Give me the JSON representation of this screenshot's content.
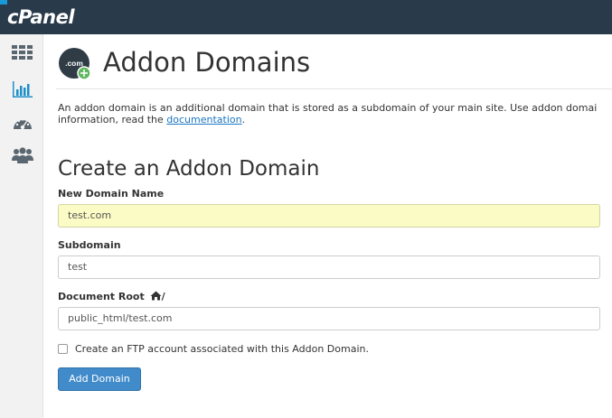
{
  "header": {
    "logo": "cPanel"
  },
  "sidebar": {
    "icons": [
      "grid-icon",
      "bar-chart-icon",
      "dashboard-gauge-icon",
      "users-icon"
    ]
  },
  "page": {
    "icon_text": ".com",
    "title": "Addon Domains",
    "description_part1": "An addon domain is an additional domain that is stored as a subdomain of your main site. Use addon domai",
    "description_part2": "information, read the ",
    "doc_link": "documentation",
    "description_part3": "."
  },
  "form": {
    "section_title": "Create an Addon Domain",
    "new_domain_label": "New Domain Name",
    "new_domain_value": "test.com",
    "subdomain_label": "Subdomain",
    "subdomain_value": "test",
    "docroot_label": "Document Root",
    "docroot_suffix": "/",
    "docroot_value": "public_html/test.com",
    "ftp_checkbox_label": "Create an FTP account associated with this Addon Domain.",
    "ftp_checked": false,
    "submit_label": "Add Domain"
  },
  "colors": {
    "topbar": "#293a4a",
    "accent": "#179bd7",
    "button": "#428bca",
    "highlight_input": "#fbfbc5",
    "link": "#1b76c2"
  }
}
